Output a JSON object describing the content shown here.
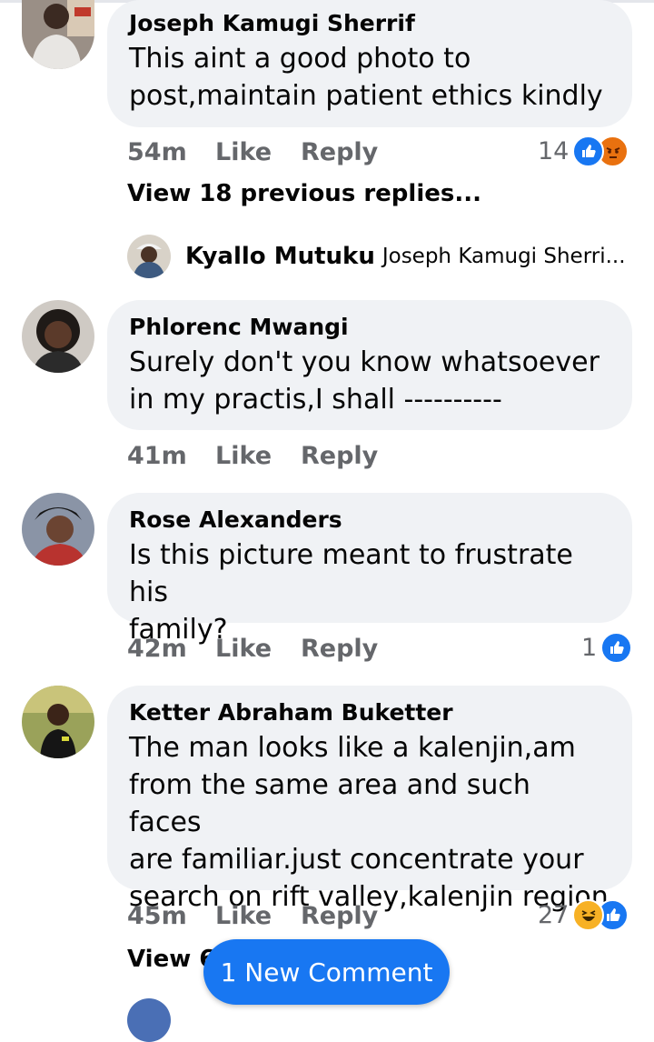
{
  "comments": [
    {
      "author": "Joseph Kamugi Sherrif",
      "text": "This aint a good photo to\npost,maintain patient ethics kindly",
      "time": "54m",
      "like_label": "Like",
      "reply_label": "Reply",
      "reaction_count": "14",
      "reactions": [
        "like-icon",
        "angry-icon"
      ]
    },
    {
      "author": "Phlorenc Mwangi",
      "text": "Surely don't you know whatsoever\nin my practis,I shall ----------",
      "time": "41m",
      "like_label": "Like",
      "reply_label": "Reply"
    },
    {
      "author": "Rose Alexanders",
      "text": "Is this picture meant to frustrate his\nfamily?",
      "time": "42m",
      "like_label": "Like",
      "reply_label": "Reply",
      "reaction_count": "1",
      "reactions": [
        "like-icon"
      ]
    },
    {
      "author": "Ketter Abraham Buketter",
      "text": "The man looks like a kalenjin,am\nfrom the same area and such faces\nare familiar.just concentrate your\nsearch on rift valley,kalenjin region",
      "time": "45m",
      "like_label": "Like",
      "reply_label": "Reply",
      "reaction_count": "27",
      "reactions": [
        "haha-icon",
        "like-icon"
      ]
    }
  ],
  "view_previous_replies": "View 18 previous replies...",
  "reply_preview": {
    "author": "Kyallo Mutuku",
    "text": "Joseph Kamugi Sherri..."
  },
  "view_more_partial": "View 6",
  "new_comment_button": "1 New Comment",
  "colors": {
    "accent": "#1877f2",
    "bubble": "#f0f2f5",
    "meta_text": "#65676b",
    "angry": "#e9710f",
    "haha": "#f7b125"
  }
}
